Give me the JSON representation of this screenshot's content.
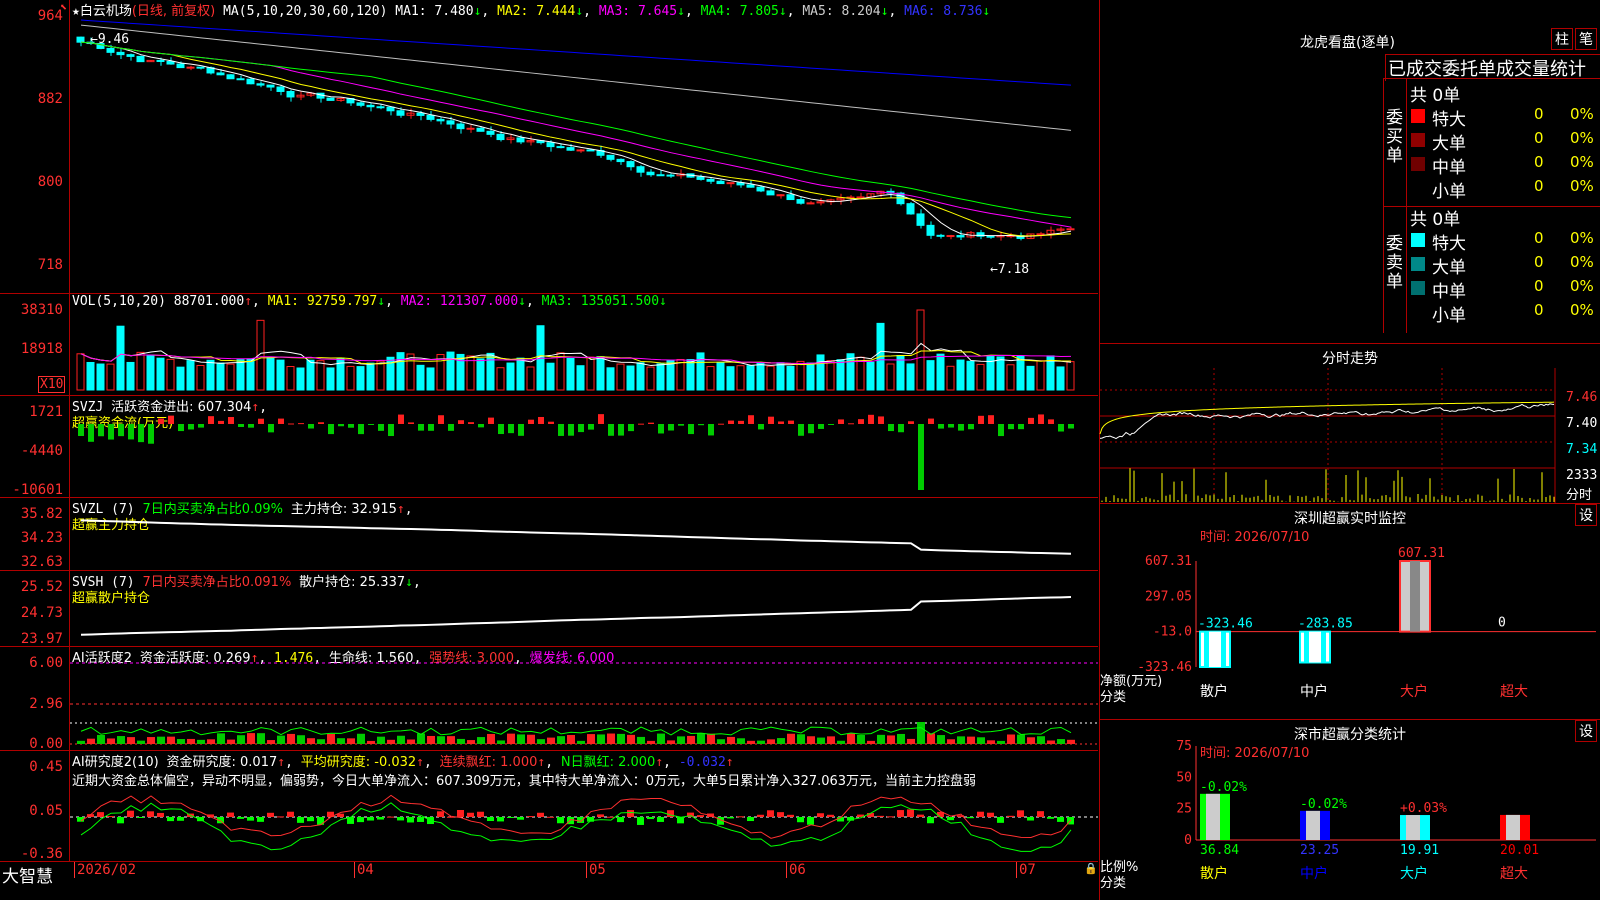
{
  "colors": {
    "up": "#ff2020",
    "down": "#00ffff",
    "bg": "#000000",
    "grid": "#b00000",
    "axis": "#ff3030",
    "ma1": "#ffffff",
    "ma2": "#ffff00",
    "ma3": "#ff00ff",
    "ma4": "#00ff00",
    "ma5": "#c0c0c0",
    "ma6": "#0000ff"
  },
  "main": {
    "title_star": "★",
    "title": "白云机场",
    "subtitle": "(日线, 前复权)",
    "ma_params": "MA(5,10,20,30,60,120)",
    "ma1": "MA1: 7.480",
    "ma2": "MA2: 7.444",
    "ma3": "MA3: 7.645",
    "ma4": "MA4: 7.805",
    "ma5": "MA5: 8.204",
    "ma6": "MA6: 8.736",
    "y_ticks": [
      "964",
      "882",
      "800",
      "718"
    ],
    "max_label": "9.46",
    "min_label": "7.18"
  },
  "vol": {
    "hdr": "VOL(5,10,20)",
    "val": "88701.000",
    "ma1": "MA1: 92759.797",
    "ma2": "MA2: 121307.000",
    "ma3": "MA3: 135051.500",
    "y_ticks": [
      "38310",
      "18918"
    ],
    "unit": "X10"
  },
  "svzj": {
    "hdr": "SVZJ",
    "label": "活跃资金进出: 607.304",
    "sub": "超赢资金流(万元)",
    "y_ticks": [
      "1721",
      "-4440",
      "-10601"
    ]
  },
  "svzl": {
    "hdr": "SVZL (7)",
    "label1": "7日内买卖净占比0.09%",
    "label2": "主力持仓: 32.915",
    "sub": "超赢主力持仓",
    "y_ticks": [
      "35.82",
      "34.23",
      "32.63"
    ]
  },
  "svsh": {
    "hdr": "SVSH (7)",
    "label1": "7日内买卖净占比0.091%",
    "label2": "散户持仓: 25.337",
    "sub": "超赢散户持仓",
    "y_ticks": [
      "25.52",
      "24.73",
      "23.97"
    ]
  },
  "ai1": {
    "hdr": "AI活跃度2",
    "l1": "资金活跃度: 0.269",
    "l2": "1.476",
    "l3": "生命线: 1.560",
    "l4": "强势线: 3.000",
    "l5": "爆发线: 6.000",
    "y_ticks": [
      "6.00",
      "2.96",
      "0.00"
    ]
  },
  "ai2": {
    "hdr": "AI研究度2(10)",
    "l1": "资金研究度: 0.017",
    "l2": "平均研究度: -0.032",
    "l3": "连续飘红: 1.000",
    "l4": "N日飘红: 2.000",
    "l5": "-0.032",
    "comment": "近期大资金总体偏空，异动不明显，偏弱势，今日大单净流入：607.309万元，其中特大单净流入：0万元，大单5日累计净入327.063万元，当前主力控盘弱",
    "y_ticks": [
      "0.45",
      "0.05",
      "-0.36"
    ]
  },
  "xaxis": {
    "brand": "大智慧",
    "labels": [
      "2026/02",
      "04",
      "05",
      "06",
      "07"
    ]
  },
  "lhb": {
    "title": "龙虎看盘(逐单)",
    "btn1": "柱",
    "btn2": "笔",
    "subtitle": "已成交委托单成交量统计",
    "buy_side": "委买单",
    "sell_side": "委卖单",
    "buy_total": "共 0单",
    "sell_total": "共 0单",
    "buy_rows": [
      {
        "name": "特大",
        "n": "0",
        "pct": "0%",
        "color": "#ff0000"
      },
      {
        "name": "大单",
        "n": "0",
        "pct": "0%",
        "color": "#900000"
      },
      {
        "name": "中单",
        "n": "0",
        "pct": "0%",
        "color": "#700000"
      },
      {
        "name": "小单",
        "n": "0",
        "pct": "0%",
        "color": "#000000"
      }
    ],
    "sell_rows": [
      {
        "name": "特大",
        "n": "0",
        "pct": "0%",
        "color": "#00ffff"
      },
      {
        "name": "大单",
        "n": "0",
        "pct": "0%",
        "color": "#008888"
      },
      {
        "name": "中单",
        "n": "0",
        "pct": "0%",
        "color": "#007070"
      },
      {
        "name": "小单",
        "n": "0",
        "pct": "0%",
        "color": "#000000"
      }
    ]
  },
  "intraday": {
    "title": "分时走势",
    "y_ticks": [
      "7.46",
      "7.40",
      "7.34"
    ],
    "vol_label": "2333",
    "vol_unit": "分时"
  },
  "monitor": {
    "title": "深圳超赢实时监控",
    "settings": "设",
    "time": "时间: 2026/07/10",
    "y_ticks": [
      "607.31",
      "297.05",
      "-13.0",
      "-323.46"
    ],
    "ylabel": "净额(万元)",
    "xlabel": "分类",
    "chart_data": {
      "type": "bar",
      "categories": [
        "散户",
        "中户",
        "大户",
        "超大"
      ],
      "values": [
        -323.46,
        -283.85,
        607.31,
        0
      ],
      "value_labels": [
        "-323.46",
        "-283.85",
        "607.31",
        "0"
      ],
      "ylim": [
        -323.46,
        607.31
      ]
    }
  },
  "classify": {
    "title": "深市超赢分类统计",
    "settings": "设",
    "time": "时间: 2026/07/10",
    "y_ticks": [
      "75",
      "50",
      "25",
      "0"
    ],
    "ylabel": "比例%",
    "xlabel": "分类",
    "chart_data": {
      "type": "bar",
      "categories": [
        "散户",
        "中户",
        "大户",
        "超大"
      ],
      "values": [
        36.84,
        23.25,
        19.91,
        20.01
      ],
      "value_labels": [
        "36.84",
        "23.25",
        "19.91",
        "20.01"
      ],
      "change_labels": [
        "-0.02%",
        "-0.02%",
        "+0.03%",
        ""
      ],
      "ylim": [
        0,
        75
      ]
    }
  }
}
